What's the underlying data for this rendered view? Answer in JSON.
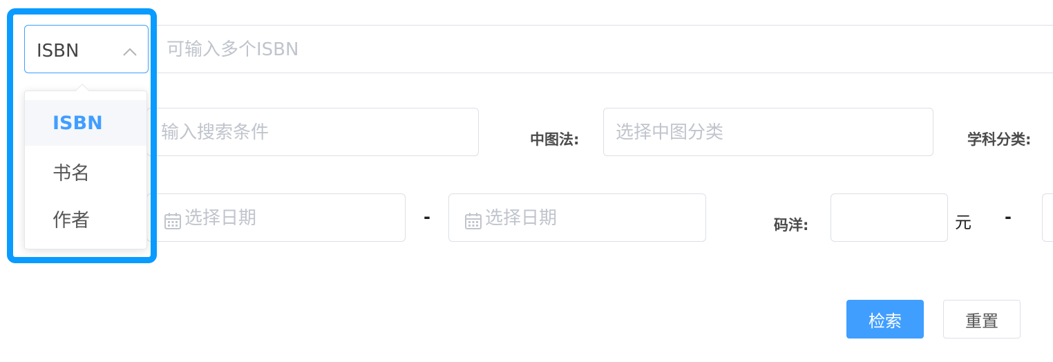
{
  "search_type": {
    "selected": "ISBN",
    "options": [
      "ISBN",
      "书名",
      "作者"
    ],
    "input_placeholder": "可输入多个ISBN"
  },
  "row2": {
    "keyword_placeholder": "输入搜索条件",
    "clc_label": "中图法:",
    "clc_placeholder": "选择中图分类",
    "subject_label": "学科分类:"
  },
  "row3": {
    "date_start_placeholder": "选择日期",
    "date_separator": "-",
    "date_end_placeholder": "选择日期",
    "price_label": "码洋:",
    "price_unit": "元",
    "price_separator": "-"
  },
  "actions": {
    "search_label": "检索",
    "reset_label": "重置"
  },
  "colors": {
    "primary": "#409eff",
    "highlight": "#0a9bff"
  }
}
